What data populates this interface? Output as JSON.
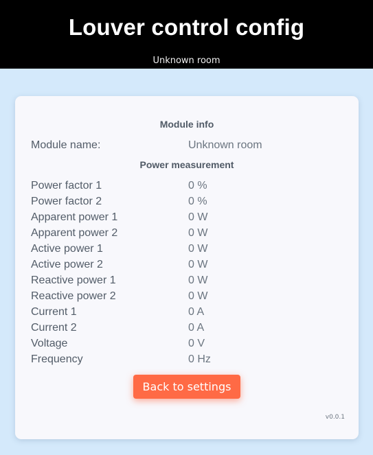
{
  "header": {
    "title": "Louver control config",
    "subtitle": "Unknown room"
  },
  "module_info": {
    "section_title": "Module info",
    "name_label": "Module name:",
    "name_value": "Unknown room"
  },
  "power_measurement": {
    "section_title": "Power measurement",
    "rows": [
      {
        "label": "Power factor 1",
        "value": "0 %"
      },
      {
        "label": "Power factor 2",
        "value": "0 %"
      },
      {
        "label": "Apparent power 1",
        "value": "0 W"
      },
      {
        "label": "Apparent power 2",
        "value": "0 W"
      },
      {
        "label": "Active power 1",
        "value": "0 W"
      },
      {
        "label": "Active power 2",
        "value": "0 W"
      },
      {
        "label": "Reactive power 1",
        "value": "0 W"
      },
      {
        "label": "Reactive power 2",
        "value": "0 W"
      },
      {
        "label": "Current 1",
        "value": "0 A"
      },
      {
        "label": "Current 2",
        "value": "0 A"
      },
      {
        "label": "Voltage",
        "value": "0 V"
      },
      {
        "label": "Frequency",
        "value": "0 Hz"
      }
    ]
  },
  "actions": {
    "back_label": "Back to settings"
  },
  "footer": {
    "version": "v0.0.1"
  },
  "colors": {
    "header_background": "#000000",
    "page_background": "#d4e9fb",
    "card_background": "#f8f8fc",
    "button_accent": "#ff6a45"
  }
}
